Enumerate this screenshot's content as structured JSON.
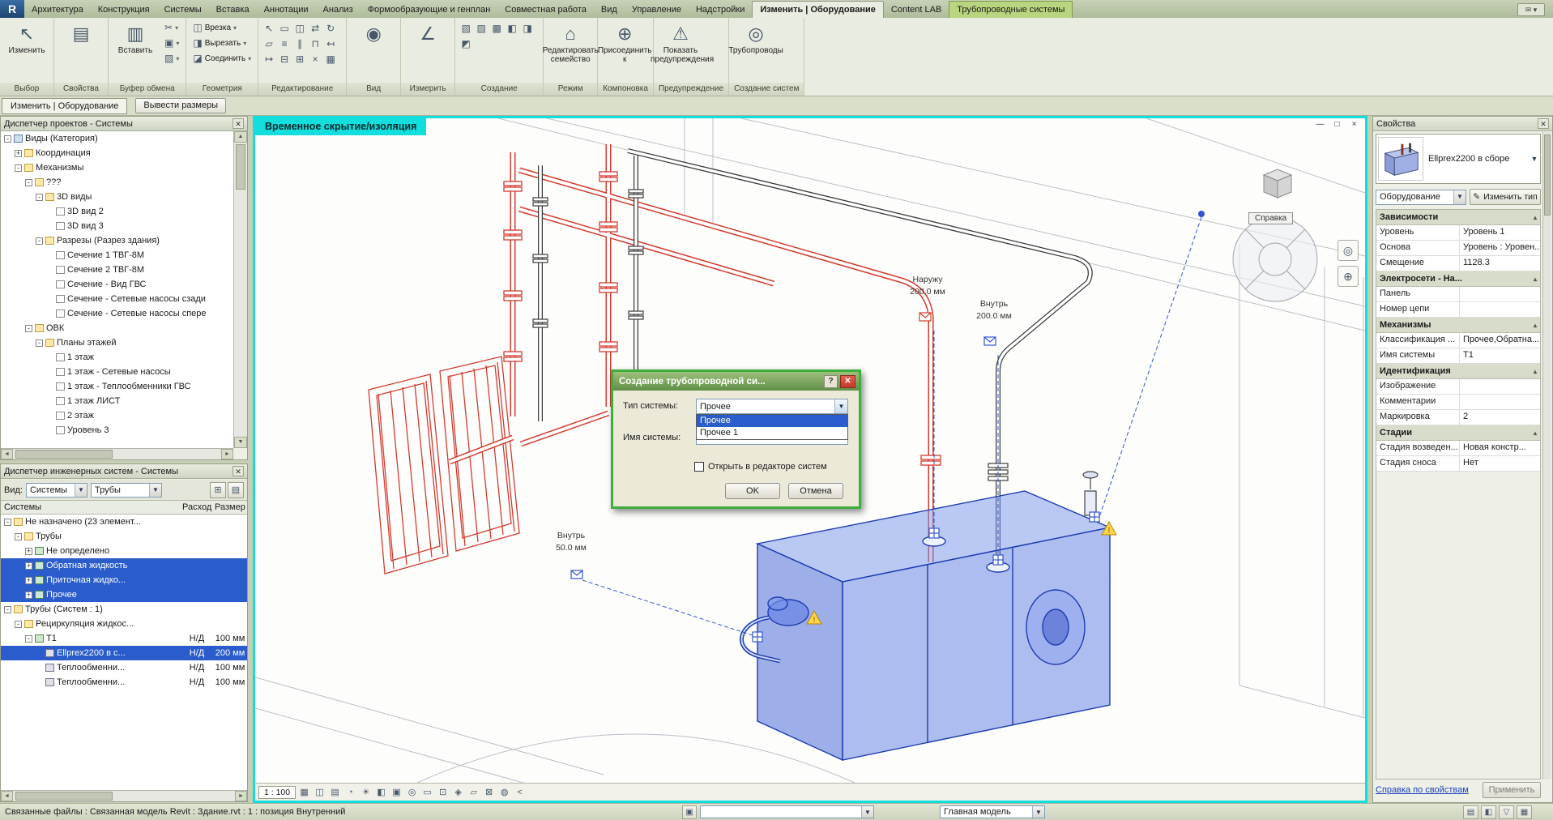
{
  "app": {
    "logo": "R",
    "tabs": [
      {
        "label": "Архитектура"
      },
      {
        "label": "Конструкция"
      },
      {
        "label": "Системы"
      },
      {
        "label": "Вставка"
      },
      {
        "label": "Аннотации"
      },
      {
        "label": "Анализ"
      },
      {
        "label": "Формообразующие и генплан"
      },
      {
        "label": "Совместная работа"
      },
      {
        "label": "Вид"
      },
      {
        "label": "Управление"
      },
      {
        "label": "Надстройки"
      },
      {
        "label": "Изменить | Оборудование",
        "active": true
      },
      {
        "label": "Content LAB"
      },
      {
        "label": "Трубопроводные системы",
        "contextual": true
      }
    ]
  },
  "ribbon": {
    "groups": [
      {
        "label": "Выбор",
        "cells": [
          {
            "t": "big",
            "label": "Изменить",
            "glyph": "↖"
          }
        ]
      },
      {
        "label": "Свойства",
        "cells": [
          {
            "t": "big",
            "label": "",
            "glyph": "▤"
          }
        ]
      },
      {
        "label": "Буфер обмена",
        "cells": [
          {
            "t": "big",
            "label": "Вставить",
            "glyph": "▥"
          },
          {
            "t": "col",
            "rows": [
              {
                "glyph": "✂",
                "label": ""
              },
              {
                "glyph": "▣",
                "label": ""
              },
              {
                "glyph": "▨",
                "label": ""
              }
            ]
          }
        ]
      },
      {
        "label": "Геометрия",
        "cells": [
          {
            "t": "col",
            "rows": [
              {
                "glyph": "◫",
                "label": "Врезка"
              },
              {
                "glyph": "◨",
                "label": "Вырезать"
              },
              {
                "glyph": "◪",
                "label": "Соединить"
              }
            ]
          }
        ]
      },
      {
        "label": "Редактирование",
        "cells": [
          {
            "t": "grid",
            "glyphs": [
              "↖",
              "▭",
              "◫",
              "⇄",
              "↻",
              "▱",
              "≡",
              "∥",
              "⊓",
              "↤",
              "↦",
              "⊟",
              "⊞",
              "×",
              "▦"
            ]
          }
        ]
      },
      {
        "label": "Вид",
        "cells": [
          {
            "t": "big",
            "label": "",
            "glyph": "◉"
          }
        ]
      },
      {
        "label": "Измерить",
        "cells": [
          {
            "t": "big",
            "label": "",
            "glyph": "∠"
          }
        ]
      },
      {
        "label": "Создание",
        "cells": [
          {
            "t": "grid",
            "glyphs": [
              "▧",
              "▨",
              "▩",
              "◧",
              "◨",
              "◩"
            ]
          }
        ]
      },
      {
        "label": "Режим",
        "cells": [
          {
            "t": "big",
            "label": "Редактировать семейство",
            "glyph": "⌂"
          }
        ]
      },
      {
        "label": "Компоновка",
        "cells": [
          {
            "t": "big",
            "label": "Присоединить к",
            "glyph": "⊕"
          }
        ]
      },
      {
        "label": "Предупреждение",
        "cells": [
          {
            "t": "big",
            "label": "Показать предупреждения",
            "glyph": "⚠"
          }
        ]
      },
      {
        "label": "Создание систем",
        "cells": [
          {
            "t": "big",
            "label": "Трубопроводы",
            "glyph": "◎"
          }
        ]
      }
    ]
  },
  "options_bar": {
    "mode_label": "Изменить | Оборудование",
    "action_label": "Вывести размеры"
  },
  "project_browser": {
    "title": "Диспетчер проектов - Системы",
    "tree": [
      {
        "label": "Виды (Категория)",
        "level": 0,
        "exp": "-",
        "icon": "root"
      },
      {
        "label": "Координация",
        "level": 1,
        "exp": "+",
        "icon": "folder"
      },
      {
        "label": "Механизмы",
        "level": 1,
        "exp": "-",
        "icon": "folder"
      },
      {
        "label": "???",
        "level": 2,
        "exp": "-",
        "icon": "folder"
      },
      {
        "label": "3D виды",
        "level": 3,
        "exp": "-",
        "icon": "folder"
      },
      {
        "label": "3D вид 2",
        "level": 4,
        "exp": "",
        "icon": "view"
      },
      {
        "label": "3D вид 3",
        "level": 4,
        "exp": "",
        "icon": "view"
      },
      {
        "label": "Разрезы (Разрез здания)",
        "level": 3,
        "exp": "-",
        "icon": "folder"
      },
      {
        "label": "Сечение 1 ТВГ-8М",
        "level": 4,
        "exp": "",
        "icon": "view"
      },
      {
        "label": "Сечение 2 ТВГ-8М",
        "level": 4,
        "exp": "",
        "icon": "view"
      },
      {
        "label": "Сечение - Вид ГВС",
        "level": 4,
        "exp": "",
        "icon": "view"
      },
      {
        "label": "Сечение - Сетевые насосы сзади",
        "level": 4,
        "exp": "",
        "icon": "view"
      },
      {
        "label": "Сечение - Сетевые насосы спере",
        "level": 4,
        "exp": "",
        "icon": "view"
      },
      {
        "label": "ОВК",
        "level": 2,
        "exp": "-",
        "icon": "folder"
      },
      {
        "label": "Планы этажей",
        "level": 3,
        "exp": "-",
        "icon": "folder"
      },
      {
        "label": "1 этаж",
        "level": 4,
        "exp": "",
        "icon": "view"
      },
      {
        "label": "1 этаж - Сетевые насосы",
        "level": 4,
        "exp": "",
        "icon": "view"
      },
      {
        "label": "1 этаж - Теплообменники ГВС",
        "level": 4,
        "exp": "",
        "icon": "view"
      },
      {
        "label": "1 этаж ЛИСТ",
        "level": 4,
        "exp": "",
        "icon": "view"
      },
      {
        "label": "2 этаж",
        "level": 4,
        "exp": "",
        "icon": "view"
      },
      {
        "label": "Уровень 3",
        "level": 4,
        "exp": "",
        "icon": "view"
      }
    ]
  },
  "system_browser": {
    "title": "Диспетчер инженерных систем - Системы",
    "view_label": "Вид:",
    "filter1": "Системы",
    "filter2": "Трубы",
    "columns": [
      "Системы",
      "Расход",
      "Размер"
    ],
    "rows": [
      {
        "label": "Не назначено (23 элемент...",
        "level": 0,
        "exp": "-",
        "icon": "folder",
        "flow": "",
        "size": "",
        "sel": false
      },
      {
        "label": "Трубы",
        "level": 1,
        "exp": "-",
        "icon": "folder",
        "flow": "",
        "size": "",
        "sel": false
      },
      {
        "label": "Не определено",
        "level": 2,
        "exp": "+",
        "icon": "sys",
        "flow": "",
        "size": "",
        "sel": false
      },
      {
        "label": "Обратная жидкость",
        "level": 2,
        "exp": "+",
        "icon": "sys",
        "flow": "",
        "size": "",
        "sel": true
      },
      {
        "label": "Приточная жидко...",
        "level": 2,
        "exp": "+",
        "icon": "sys",
        "flow": "",
        "size": "",
        "sel": true
      },
      {
        "label": "Прочее",
        "level": 2,
        "exp": "+",
        "icon": "sys",
        "flow": "",
        "size": "",
        "sel": true
      },
      {
        "label": "Трубы (Систем : 1)",
        "level": 0,
        "exp": "-",
        "icon": "folder",
        "flow": "",
        "size": "",
        "sel": false
      },
      {
        "label": "Рециркуляция жидкос...",
        "level": 1,
        "exp": "-",
        "icon": "folder",
        "flow": "",
        "size": "",
        "sel": false
      },
      {
        "label": "Т1",
        "level": 2,
        "exp": "-",
        "icon": "sys",
        "flow": "Н/Д",
        "size": "100 мм",
        "sel": false
      },
      {
        "label": "Ellprex2200 в с...",
        "level": 3,
        "exp": "",
        "icon": "eq",
        "flow": "Н/Д",
        "size": "200 мм",
        "sel": true
      },
      {
        "label": "Теплообменни...",
        "level": 3,
        "exp": "",
        "icon": "eq",
        "flow": "Н/Д",
        "size": "100 мм",
        "sel": false
      },
      {
        "label": "Теплообменни...",
        "level": 3,
        "exp": "",
        "icon": "eq",
        "flow": "Н/Д",
        "size": "100 мм",
        "sel": false
      }
    ]
  },
  "dialog": {
    "title": "Создание трубопроводной си...",
    "help": "?",
    "close": "✕",
    "type_label": "Тип системы:",
    "name_label": "Имя системы:",
    "type_value": "Прочее",
    "options": [
      {
        "label": "Прочее",
        "sel": true
      },
      {
        "label": "Прочее 1",
        "sel": false
      }
    ],
    "checkbox_label": "Открыть в редакторе систем",
    "ok_label": "OK",
    "cancel_label": "Отмена"
  },
  "properties": {
    "title": "Свойства",
    "type_name": "Ellprex2200 в сборе",
    "category": "Оборудование",
    "edit_type": "Изменить тип",
    "sections": [
      {
        "header": "Зависимости",
        "rows": [
          [
            "Уровень",
            "Уровень 1"
          ],
          [
            "Основа",
            "Уровень : Уровен..."
          ],
          [
            "Смещение",
            "1128.3"
          ]
        ]
      },
      {
        "header": "Электросети - На...",
        "rows": [
          [
            "Панель",
            ""
          ],
          [
            "Номер цепи",
            ""
          ]
        ]
      },
      {
        "header": "Механизмы",
        "rows": [
          [
            "Классификация ...",
            "Прочее,Обратна..."
          ],
          [
            "Имя системы",
            "Т1"
          ]
        ]
      },
      {
        "header": "Идентификация",
        "rows": [
          [
            "Изображение",
            ""
          ],
          [
            "Комментарии",
            ""
          ],
          [
            "Маркировка",
            "2"
          ]
        ]
      },
      {
        "header": "Стадии",
        "rows": [
          [
            "Стадия возведен...",
            "Новая констр..."
          ],
          [
            "Стадия сноса",
            "Нет"
          ]
        ]
      }
    ],
    "help_link": "Справка по свойствам",
    "apply_label": "Применить"
  },
  "view": {
    "hide_label": "Временное скрытие/изоляция",
    "scale": "1 : 100",
    "nav_tooltip": "Справка",
    "annotations": [
      {
        "l1": "Наружу",
        "l2": "200.0 мм"
      },
      {
        "l1": "Внутрь",
        "l2": "200.0 мм"
      },
      {
        "l1": "Внутрь",
        "l2": "50.0 мм"
      }
    ],
    "toolbar_glyphs": [
      "▦",
      "◫",
      "▤",
      "◔",
      "☀",
      "◧",
      "▣",
      "◎",
      "▭",
      "⊡",
      "◈",
      "▱",
      "⊠",
      "◍",
      "<"
    ]
  },
  "status_bar": {
    "left_text": "Связанные файлы : Связанная модель Revit : Здание.rvt : 1 : позиция Внутренний",
    "model_option": "Главная модель",
    "icons": [
      {
        "name": "worksets-icon",
        "glyph": "▤"
      },
      {
        "name": "design-options-icon",
        "glyph": "◧"
      },
      {
        "name": "filter-icon",
        "glyph": "▽"
      },
      {
        "name": "select-toggle-icon",
        "glyph": "▦"
      }
    ]
  }
}
